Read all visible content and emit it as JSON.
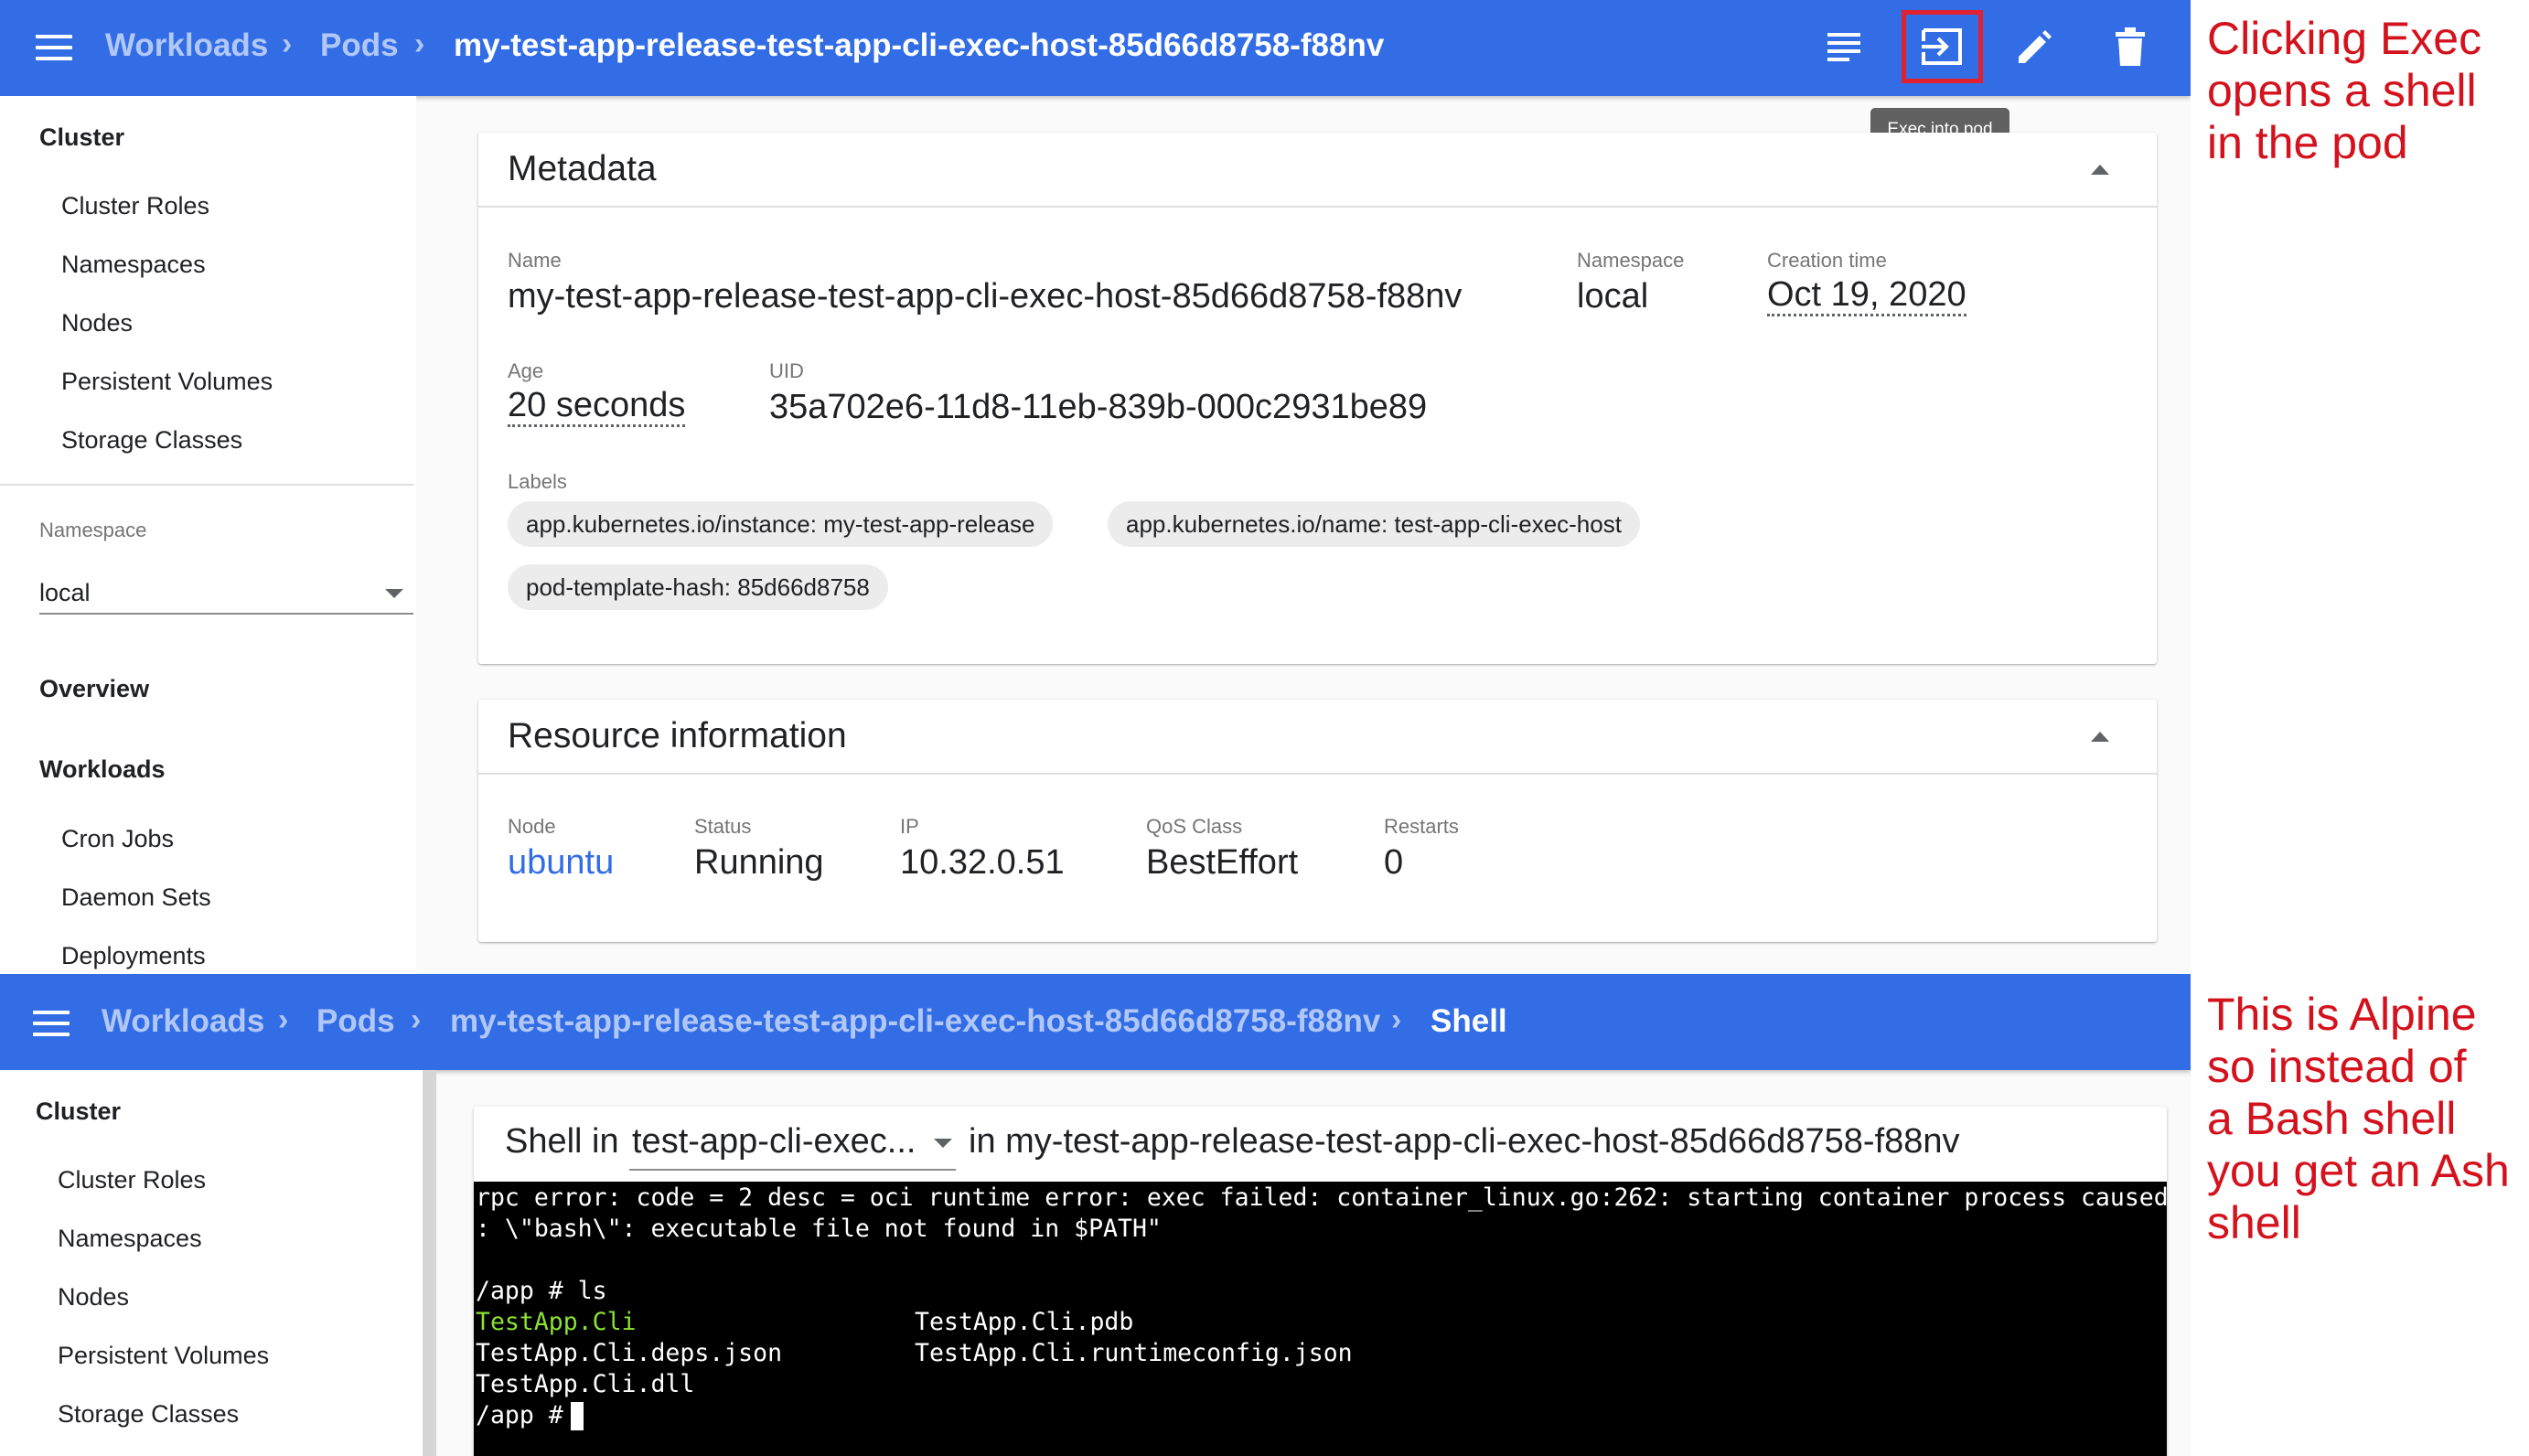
{
  "panel1": {
    "breadcrumb": [
      "Workloads",
      "Pods",
      "my-test-app-release-test-app-cli-exec-host-85d66d8758-f88nv"
    ],
    "toolbar": {
      "tooltip": "Exec into pod"
    },
    "sidebar": {
      "cluster_heading": "Cluster",
      "cluster_items": [
        "Cluster Roles",
        "Namespaces",
        "Nodes",
        "Persistent Volumes",
        "Storage Classes"
      ],
      "namespace_label": "Namespace",
      "namespace_value": "local",
      "overview": "Overview",
      "workloads": "Workloads",
      "workload_items": [
        "Cron Jobs",
        "Daemon Sets",
        "Deployments"
      ]
    },
    "metadata": {
      "title": "Metadata",
      "name_label": "Name",
      "name": "my-test-app-release-test-app-cli-exec-host-85d66d8758-f88nv",
      "namespace_label": "Namespace",
      "namespace": "local",
      "creation_label": "Creation time",
      "creation": "Oct 19, 2020",
      "age_label": "Age",
      "age": "20 seconds",
      "uid_label": "UID",
      "uid": "35a702e6-11d8-11eb-839b-000c2931be89",
      "labels_label": "Labels",
      "labels": [
        "app.kubernetes.io/instance: my-test-app-release",
        "app.kubernetes.io/name: test-app-cli-exec-host",
        "pod-template-hash: 85d66d8758"
      ]
    },
    "resource": {
      "title": "Resource information",
      "node_label": "Node",
      "node": "ubuntu",
      "status_label": "Status",
      "status": "Running",
      "ip_label": "IP",
      "ip": "10.32.0.51",
      "qos_label": "QoS Class",
      "qos": "BestEffort",
      "restarts_label": "Restarts",
      "restarts": "0"
    }
  },
  "panel2": {
    "breadcrumb": [
      "Workloads",
      "Pods",
      "my-test-app-release-test-app-cli-exec-host-85d66d8758-f88nv",
      "Shell"
    ],
    "sidebar": {
      "cluster_heading": "Cluster",
      "cluster_items": [
        "Cluster Roles",
        "Namespaces",
        "Nodes",
        "Persistent Volumes",
        "Storage Classes"
      ]
    },
    "shell": {
      "prefix": "Shell in",
      "container": "test-app-cli-exec...",
      "suffix": "in my-test-app-release-test-app-cli-exec-host-85d66d8758-f88nv",
      "terminal": {
        "error_line1": "rpc error: code = 2 desc = oci runtime error: exec failed: container_linux.go:262: starting container process caused \"exec",
        "error_line2": ": \\\"bash\\\": executable file not found in $PATH\"",
        "cmd_line": "/app # ls",
        "file1": "TestApp.Cli",
        "file2": "TestApp.Cli.pdb",
        "file3": "TestApp.Cli.deps.json",
        "file4": "TestApp.Cli.runtimeconfig.json",
        "file5": "TestApp.Cli.dll",
        "prompt": "/app # "
      }
    }
  },
  "annotations": {
    "top": [
      "Clicking Exec",
      "opens a shell",
      "in the pod"
    ],
    "bottom": [
      "This is Alpine",
      "so instead of",
      "a Bash shell",
      "you get an Ash",
      "shell"
    ]
  },
  "colors": {
    "header": "#326de6",
    "annotation": "#d4121d",
    "highlight_box": "#e0212f",
    "link": "#326de6",
    "exec_file": "#8ae234"
  }
}
